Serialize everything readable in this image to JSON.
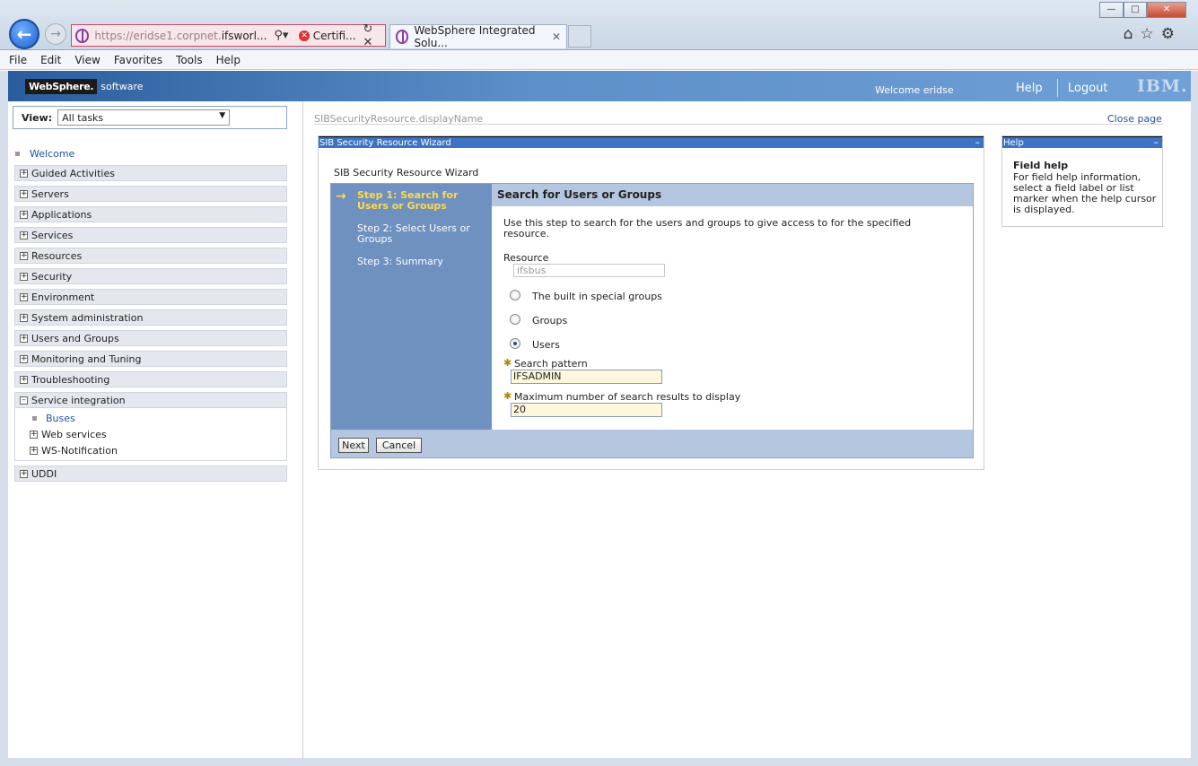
{
  "browser": {
    "url_prefix": "https://eridse1.corpnet.",
    "url_host": "ifsworl...",
    "cert_label": "Certifi...",
    "tab_title": "WebSphere Integrated Solu...",
    "menu": [
      "File",
      "Edit",
      "View",
      "Favorites",
      "Tools",
      "Help"
    ]
  },
  "header": {
    "logo_brand": "WebSphere.",
    "logo_sub": "software",
    "welcome": "Welcome eridse",
    "help": "Help",
    "logout": "Logout",
    "ibm": "IBM."
  },
  "nav": {
    "view_label": "View:",
    "view_value": "All tasks",
    "welcome": "Welcome",
    "groups": [
      "Guided Activities",
      "Servers",
      "Applications",
      "Services",
      "Resources",
      "Security",
      "Environment",
      "System administration",
      "Users and Groups",
      "Monitoring and Tuning",
      "Troubleshooting",
      "Service integration"
    ],
    "service_integration_items": [
      "Buses",
      "Web services",
      "WS-Notification"
    ],
    "uddi": "UDDI"
  },
  "content": {
    "breadcrumb": "SIBSecurityResource.displayName",
    "close_page": "Close page",
    "portlet_title": "SIB Security Resource Wizard",
    "wizard_caption": "SIB Security Resource Wizard",
    "steps": [
      "Step  1:  Search for Users or Groups",
      "Step  2:  Select Users or Groups",
      "Step  3:  Summary"
    ],
    "step_heading": "Search for Users or Groups",
    "description": "Use this step to search for the users and groups to give access to for the specified resource.",
    "resource_label": "Resource",
    "resource_value": "ifsbus",
    "radio_options": [
      "The built in special groups",
      "Groups",
      "Users"
    ],
    "selected_radio": "Users",
    "search_pattern_label": "Search pattern",
    "search_pattern_value": "IFSADMIN",
    "max_results_label": "Maximum number of search results to display",
    "max_results_value": "20",
    "next": "Next",
    "cancel": "Cancel"
  },
  "help": {
    "title": "Help",
    "heading": "Field help",
    "text": "For field help information, select a field label or list marker when the help cursor is displayed."
  }
}
